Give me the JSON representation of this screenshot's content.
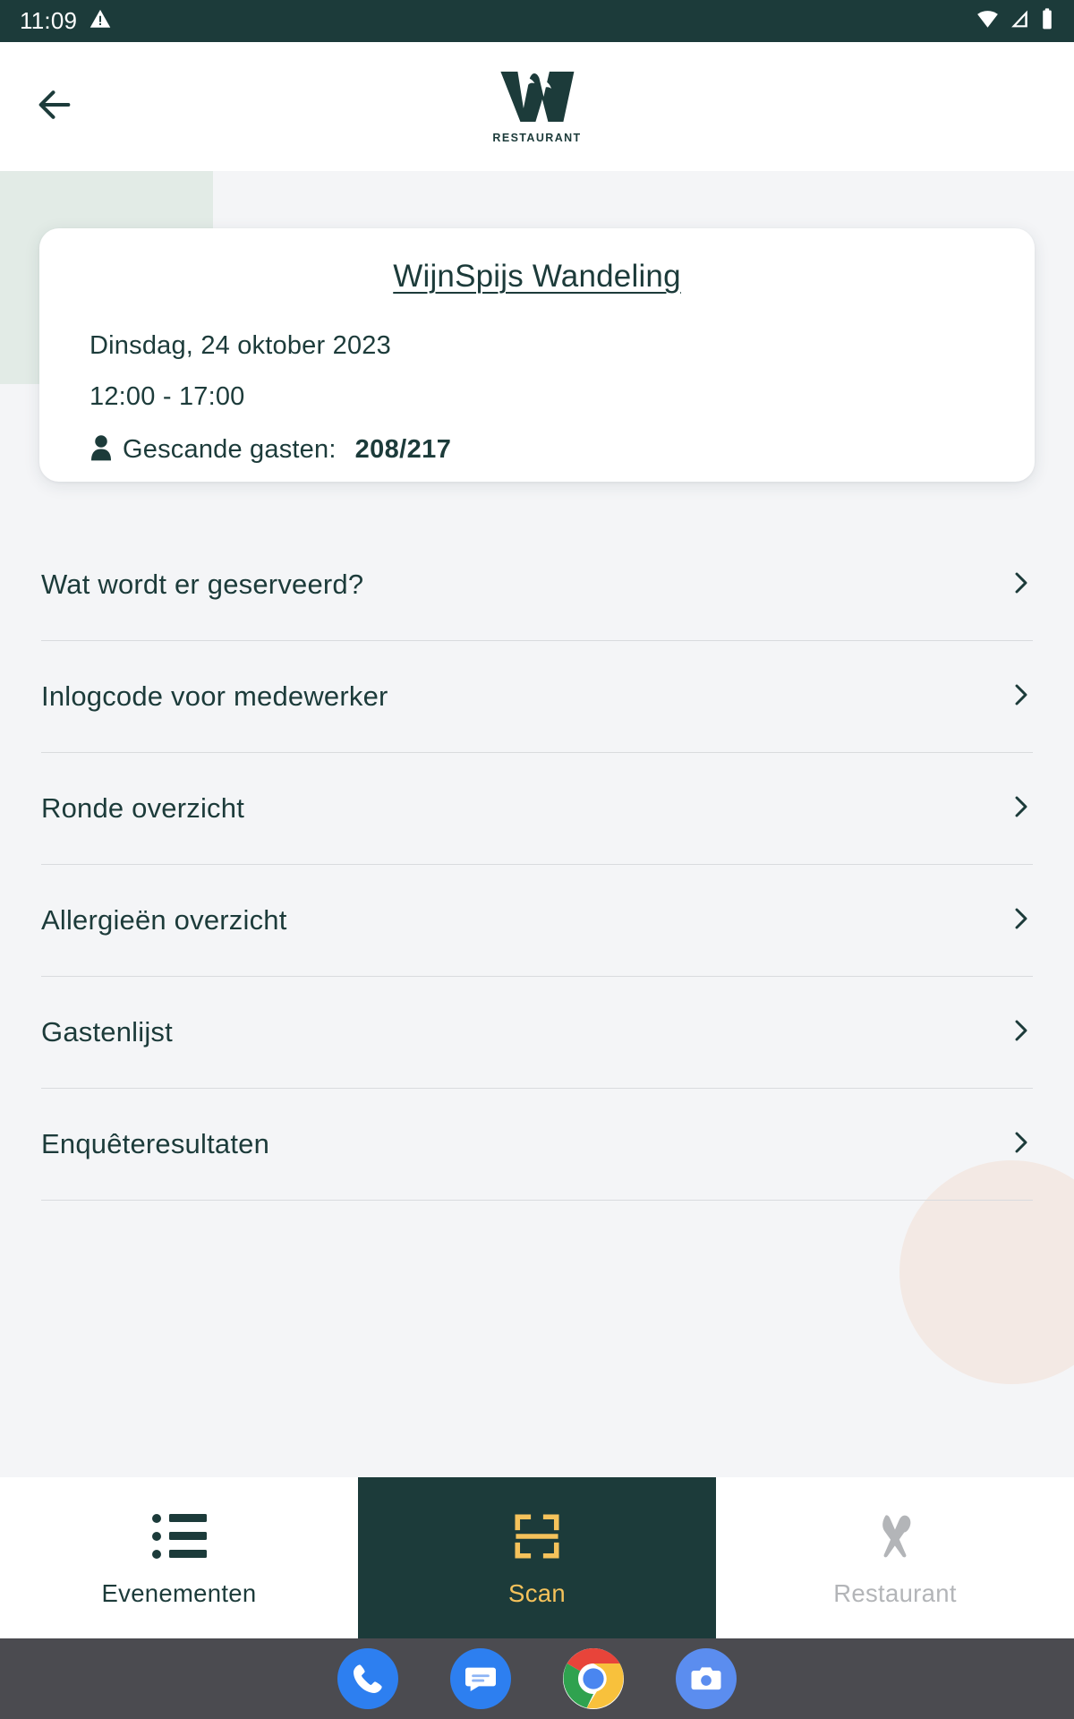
{
  "status_bar": {
    "time": "11:09",
    "icons": [
      "warning-triangle-icon",
      "wifi-icon",
      "cell-signal-icon",
      "battery-icon"
    ],
    "background_color": "#1c3b3a"
  },
  "app_bar": {
    "back_icon": "arrow-left-icon",
    "logo_letter": "W",
    "logo_subtitle": "RESTAURANT",
    "background_color": "#ffffff"
  },
  "event_card": {
    "title": "WijnSpijs Wandeling",
    "date": "Dinsdag, 24 oktober 2023",
    "time_range": "12:00 - 17:00",
    "guests_icon": "person-icon",
    "guests_label": "Gescande gasten:",
    "guests_count": "208/217"
  },
  "menu": {
    "items": [
      {
        "label": "Wat wordt er geserveerd?",
        "chevron": "chevron-right-icon"
      },
      {
        "label": "Inlogcode voor medewerker",
        "chevron": "chevron-right-icon"
      },
      {
        "label": "Ronde overzicht",
        "chevron": "chevron-right-icon"
      },
      {
        "label": "Allergieën overzicht",
        "chevron": "chevron-right-icon"
      },
      {
        "label": "Gastenlijst",
        "chevron": "chevron-right-icon"
      },
      {
        "label": "Enquêteresultaten",
        "chevron": "chevron-right-icon"
      }
    ]
  },
  "bottom_nav": {
    "items": [
      {
        "label": "Evenementen",
        "icon": "list-icon",
        "state": "default"
      },
      {
        "label": "Scan",
        "icon": "qr-scan-icon",
        "state": "active"
      },
      {
        "label": "Restaurant",
        "icon": "fork-spoon-icon",
        "state": "disabled"
      }
    ],
    "active_background": "#1c3b3a",
    "active_color": "#f5c25b",
    "disabled_color": "#b3b5b8"
  },
  "android_dock": {
    "apps": [
      "phone-icon",
      "messages-icon",
      "chrome-icon",
      "camera-icon"
    ],
    "background_color": "#4b4b50"
  },
  "theme": {
    "primary": "#1c3b3a",
    "page_background": "#f4f5f7",
    "accent_yellow": "#f5c25b",
    "blob_green": "#e2ebe6",
    "blob_pink": "#f3e9e4"
  }
}
